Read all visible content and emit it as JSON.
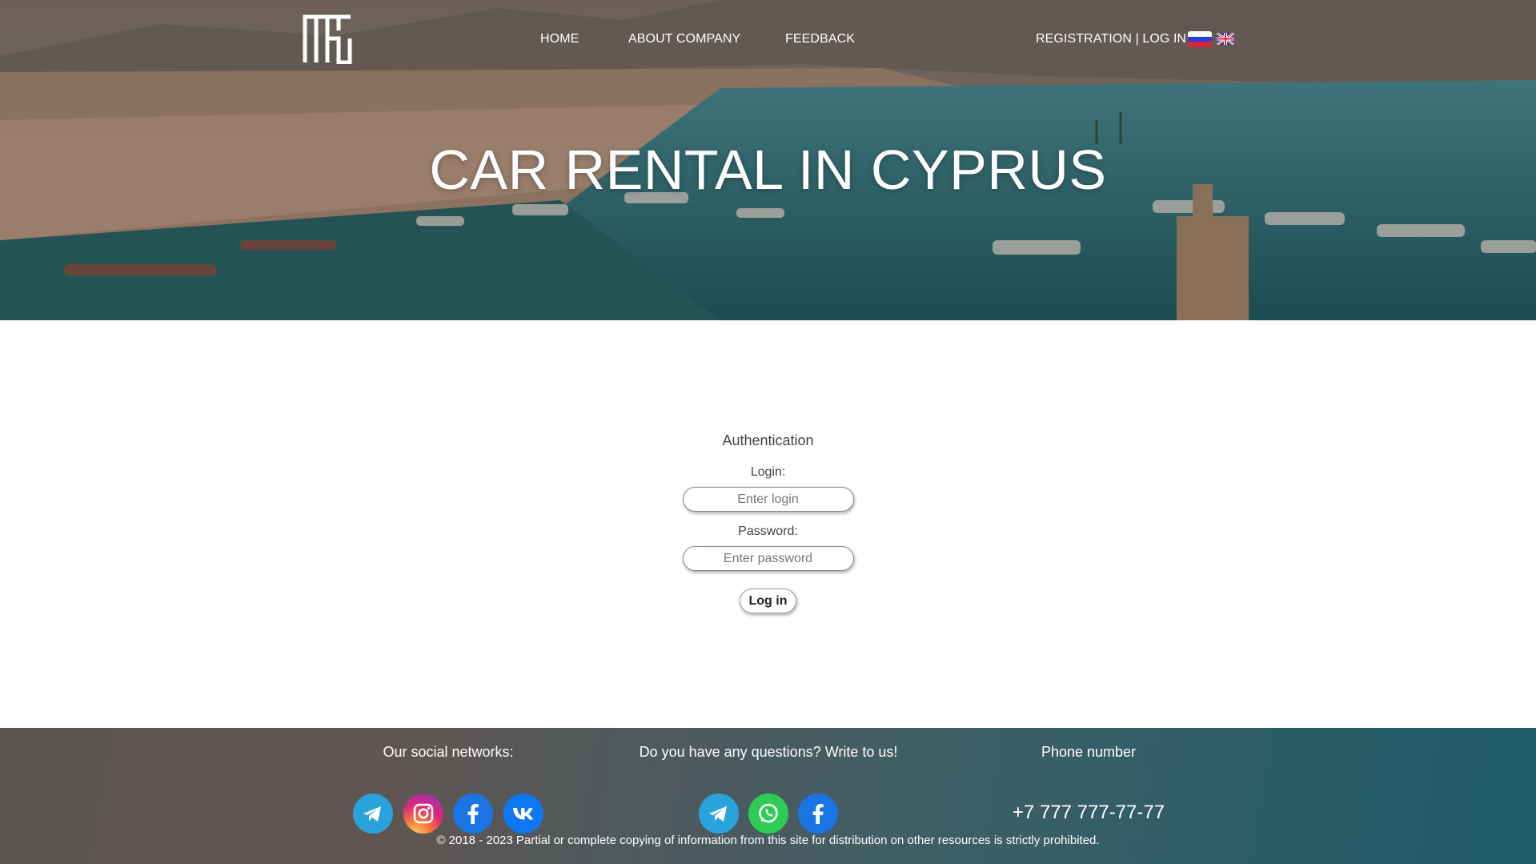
{
  "header": {
    "nav": {
      "home": "HOME",
      "about": "ABOUT COMPANY",
      "feedback": "FEEDBACK",
      "auth": "REGISTRATION | LOG IN"
    },
    "languages": [
      "ru-flag-icon",
      "uk-flag-icon"
    ],
    "hero_title": "CAR RENTAL IN CYPRUS"
  },
  "auth": {
    "title": "Authentication",
    "login_label": "Login:",
    "login_placeholder": "Enter login",
    "login_value": "",
    "password_label": "Password:",
    "password_placeholder": "Enter password",
    "password_value": "",
    "submit_label": "Log in"
  },
  "footer": {
    "social_heading": "Our social networks:",
    "social_icons": [
      "telegram-icon",
      "instagram-icon",
      "facebook-icon",
      "vk-icon"
    ],
    "contact_heading": "Do you have any questions? Write to us!",
    "contact_icons": [
      "telegram-icon",
      "whatsapp-icon",
      "facebook-icon"
    ],
    "phone_heading": "Phone number",
    "phone": "+7 777 777-77-77",
    "copyright": "© 2018 - 2023 Partial or complete copying of information from this site for distribution on other resources is strictly prohibited."
  },
  "colors": {
    "telegram": "#2aa3dd",
    "facebook": "#1b74e4",
    "vk": "#0f77f2",
    "whatsapp": "#2ecc55"
  }
}
